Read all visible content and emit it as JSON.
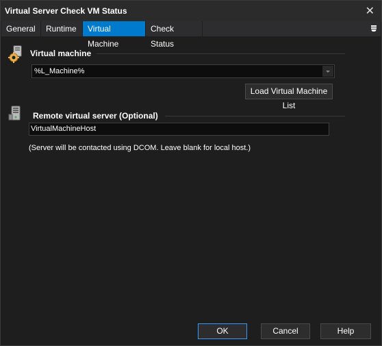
{
  "window": {
    "title": "Virtual Server Check VM Status",
    "close_glyph": "✕"
  },
  "tabs": [
    {
      "label": "General",
      "active": false
    },
    {
      "label": "Runtime",
      "active": false
    },
    {
      "label": "Virtual Machine",
      "active": true
    },
    {
      "label": "Check Status",
      "active": false
    }
  ],
  "tab_menu_icon": "hamburger-icon",
  "virtual_machine": {
    "section_label": "Virtual machine",
    "icon": "gear-computer-icon",
    "combo_value": "%L_Machine%",
    "load_button_label": "Load Virtual Machine List"
  },
  "remote_server": {
    "section_label": "Remote virtual server (Optional)",
    "icon": "server-tower-icon",
    "value": "VirtualMachineHost",
    "note": "(Server will be contacted using DCOM. Leave blank for local host.)"
  },
  "footer": {
    "ok_label": "OK",
    "cancel_label": "Cancel",
    "help_label": "Help"
  },
  "colors": {
    "background": "#1e1e1e",
    "active_tab": "#007acc",
    "primary_border": "#3399ff"
  }
}
